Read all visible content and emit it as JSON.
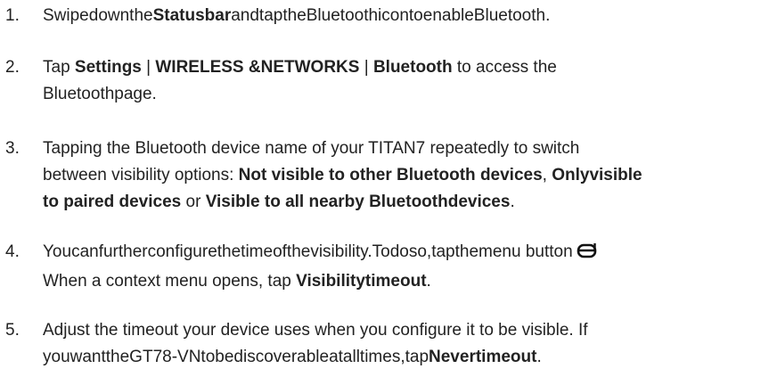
{
  "steps": [
    {
      "number": "1.",
      "lines": [
        [
          "Swipedownthe",
          "Statusbar",
          "andtaptheBluetoothicontoenableBluetooth."
        ]
      ]
    },
    {
      "number": "2.",
      "lines": [
        [
          "Tap ",
          "Settings",
          " | ",
          "WIRELESS &NETWORKS",
          " | ",
          "Bluetooth",
          " to access the"
        ],
        [
          "Bluetoothpage."
        ]
      ]
    },
    {
      "number": "3.",
      "lines": [
        [
          "Tapping the Bluetooth device name of your TITAN7 repeatedly to switch"
        ],
        [
          "between visibility options: ",
          "Not visible to other Bluetooth devices",
          ", ",
          "Onlyvisible"
        ],
        [
          "to paired devices",
          " or ",
          "Visible to all nearby Bluetoothdevices",
          "."
        ]
      ]
    },
    {
      "number": "4.",
      "lines": [
        [
          "Youcanfurtherconfigurethetimeofthevisibility.Todoso,tapthemenu button"
        ],
        [
          "When a context menu opens, tap ",
          "Visibilitytimeout",
          "."
        ]
      ],
      "icon": "menu-button-icon"
    },
    {
      "number": "5.",
      "lines": [
        [
          "Adjust the timeout your device uses when you configure it to be visible. If"
        ],
        [
          "youwanttheGT78-VNtobediscoverableatalltimes,tap",
          "Nevertimeout",
          "."
        ]
      ]
    }
  ]
}
